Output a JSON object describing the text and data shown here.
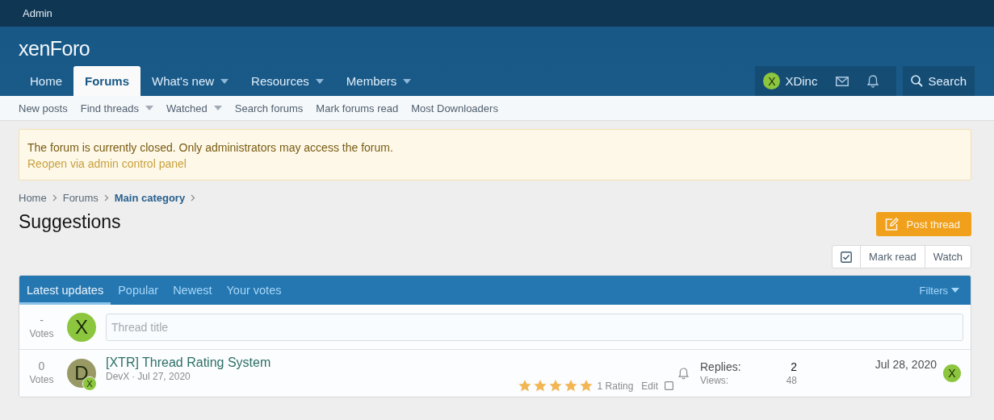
{
  "top_bar": {
    "label": "Admin"
  },
  "logo": {
    "text": "xenForo"
  },
  "nav": {
    "tabs": [
      {
        "label": "Home",
        "selected": false,
        "dropdown": false
      },
      {
        "label": "Forums",
        "selected": true,
        "dropdown": false
      },
      {
        "label": "What's new",
        "selected": false,
        "dropdown": true
      },
      {
        "label": "Resources",
        "selected": false,
        "dropdown": true
      },
      {
        "label": "Members",
        "selected": false,
        "dropdown": true
      }
    ]
  },
  "user_menu": {
    "avatar": {
      "letter": "X",
      "color": "#8cc63e"
    },
    "username": "XDinc"
  },
  "search": {
    "label": "Search"
  },
  "sub_nav": [
    {
      "label": "New posts",
      "dropdown": false
    },
    {
      "label": "Find threads",
      "dropdown": true
    },
    {
      "label": "Watched",
      "dropdown": true
    },
    {
      "label": "Search forums",
      "dropdown": false
    },
    {
      "label": "Mark forums read",
      "dropdown": false
    },
    {
      "label": "Most Downloaders",
      "dropdown": false
    }
  ],
  "notice": {
    "message": "The forum is currently closed. Only administrators may access the forum.",
    "link": "Reopen via admin control panel"
  },
  "breadcrumbs": [
    {
      "label": "Home",
      "current": false
    },
    {
      "label": "Forums",
      "current": false
    },
    {
      "label": "Main category",
      "current": true
    }
  ],
  "page_title": "Suggestions",
  "post_button": {
    "label": "Post thread"
  },
  "actions": [
    {
      "label": "Mark read"
    },
    {
      "label": "Watch"
    }
  ],
  "block_tabs": [
    {
      "label": "Latest updates",
      "selected": true
    },
    {
      "label": "Popular",
      "selected": false
    },
    {
      "label": "Newest",
      "selected": false
    },
    {
      "label": "Your votes",
      "selected": false
    }
  ],
  "filters": {
    "label": "Filters"
  },
  "quick_thread": {
    "votes": "-",
    "votes_label": "Votes",
    "avatar": {
      "letter": "X",
      "color": "#8cc63e"
    },
    "placeholder": "Thread title"
  },
  "threads": [
    {
      "votes": "0",
      "votes_label": "Votes",
      "avatar": {
        "letter": "D",
        "color": "#999966"
      },
      "badge": {
        "letter": "X",
        "color": "#8cc63e"
      },
      "title": "[XTR] Thread Rating System",
      "author": "DevX",
      "separator": "·",
      "date": "Jul 27, 2020",
      "stars": 5,
      "rating": "1 Rating",
      "edit": "Edit",
      "checked": false,
      "replies_label": "Replies:",
      "replies": "2",
      "views_label": "Views:",
      "views": "48",
      "last_date": "Jul 28, 2020",
      "last_avatar": {
        "letter": "X",
        "color": "#8cc63e"
      }
    }
  ]
}
